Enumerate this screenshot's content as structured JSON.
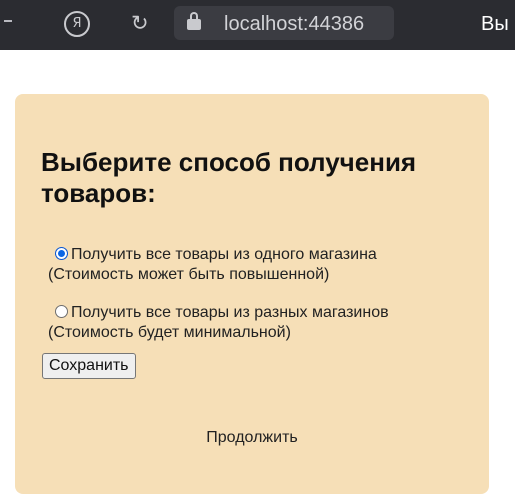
{
  "browser": {
    "address": "localhost:44386",
    "truncated_label": "Вы",
    "icons": [
      "yandex-icon",
      "reload-icon",
      "lock-icon"
    ]
  },
  "colors": {
    "card_background": "#f6dfb7",
    "chrome_background": "#2b2c31",
    "radio_selected": "#0b66e4"
  },
  "form": {
    "title": "Выберите способ получения товаров:",
    "options": [
      {
        "label": "Получить все товары из одного магазина",
        "note": "(Стоимость может быть повышенной)",
        "selected": true
      },
      {
        "label": "Получить все товары из разных магазинов",
        "note": "(Стоимость будет минимальной)",
        "selected": false
      }
    ],
    "save_label": "Сохранить",
    "continue_label": "Продолжить"
  }
}
